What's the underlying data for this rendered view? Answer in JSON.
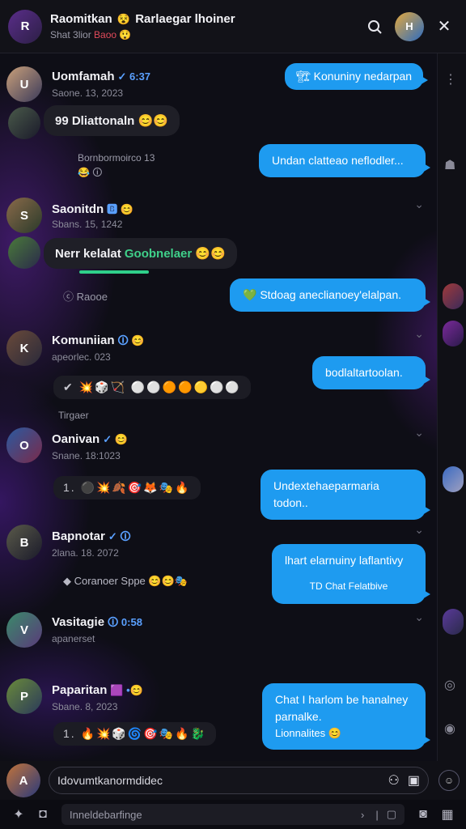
{
  "header": {
    "title": "Raomitkan",
    "title_emoji": "😵",
    "title_suffix": "Rarlaegar lhoiner",
    "subtitle": "Shat 3lior",
    "subtitle_tag": "Baoo",
    "subtitle_emoji": "😲",
    "avatar_initials": "R",
    "header_avatar_initials": "H"
  },
  "messages": [
    {
      "name": "Uomfamah",
      "badge": "✓ 6:37",
      "time": "Saone. 13, 2023",
      "incoming": "99 Dliattonaln 😊😊",
      "note": "Bornbormoirco 13",
      "note2": "😂 🛈",
      "outgoing_top": "🏗 Konuniny nedarpan",
      "outgoing": "Undan clatteao neflodler..."
    },
    {
      "name": "Saonitdn",
      "badge": "🅱 😊",
      "time": "Sbans. 15, 1242",
      "incoming_a": "Nerr kelalat",
      "incoming_b": "Goobnelaer",
      "incoming_emoji": "😊😊",
      "note": "Raooe",
      "outgoing": "💚 Stdoag aneclianoey'elalpan."
    },
    {
      "name": "Komuniian",
      "badge": "🛈 😊",
      "time": "apeorlec. 023",
      "reactions": "✔  💥🎲🏹  ⚪⚪🟠🟠🟡⚪⚪",
      "note": "Tirgaer",
      "outgoing": "bodlaltartoolan."
    },
    {
      "name": "Oanivan",
      "badge": "✓ 😊",
      "time": "Snane. 18:1023",
      "reactions": "1.  ⚫💥🍂🎯🦊🎭🔥",
      "outgoing": "Undextehaeparmaria todon.."
    },
    {
      "name": "Bapnotar",
      "badge": "✓ 🛈",
      "time": "2lana. 18. 2072",
      "note": "Coranoer Sppe",
      "note_emoji": "😊😊🎭",
      "outgoing": "lhart elarnuiny laflantivy",
      "outgoing_sub": "TD Chat Felatbive"
    },
    {
      "name": "Vasitagie",
      "badge": "🛈 0:58",
      "time": "apanerset",
      "outgoing": ""
    },
    {
      "name": "Paparitan",
      "badge": "🟪 •😊",
      "time": "Sbane. 8, 2023",
      "reactions": "1.  🔥💥🎲🌀🎯🎭🔥🐉",
      "outgoing": "Chat I harlom be hanalney",
      "outgoing_line2": "parnalke.",
      "outgoing_line3": "Lionnalites 😊"
    }
  ],
  "composer": {
    "placeholder": "Idovumtkanormdidec",
    "avatar_initials": "A"
  },
  "bottom_bar": {
    "field_text": "Inneldebarfinge"
  }
}
